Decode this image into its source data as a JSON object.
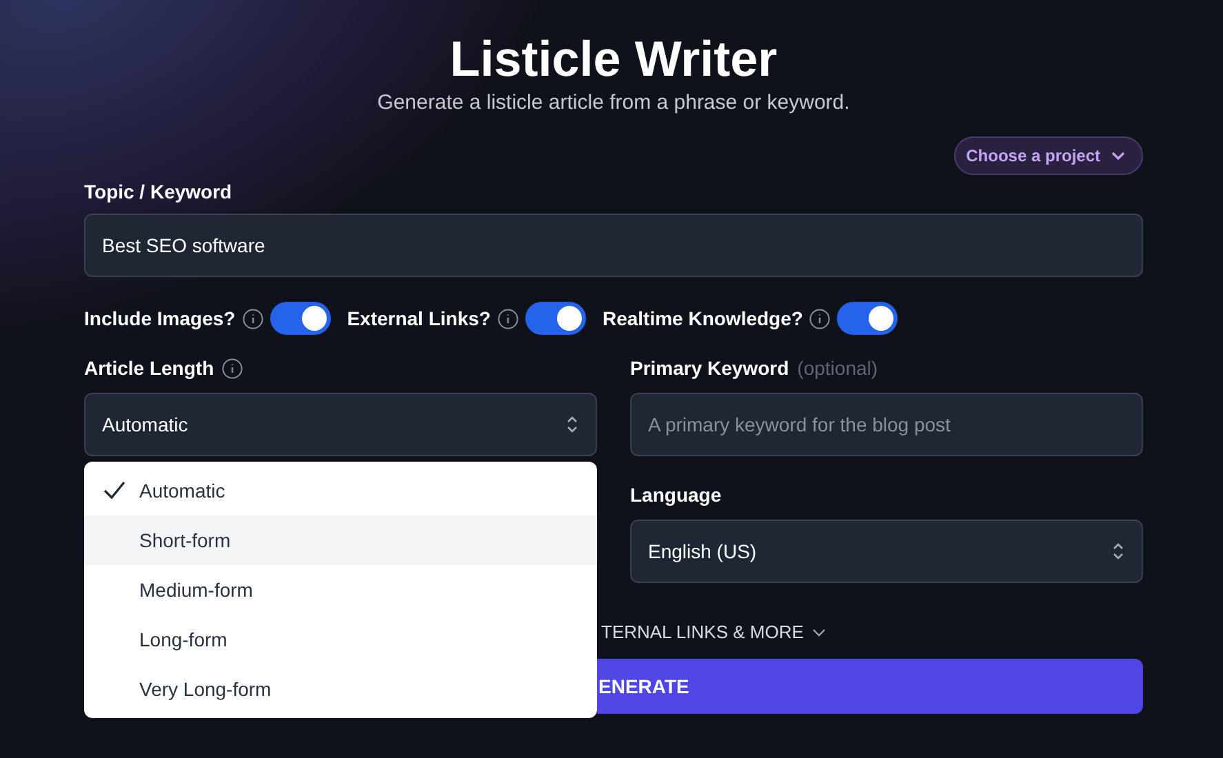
{
  "header": {
    "title": "Listicle Writer",
    "subtitle": "Generate a listicle article from a phrase or keyword."
  },
  "project_button": {
    "label": "Choose a project"
  },
  "topic": {
    "label": "Topic / Keyword",
    "value": "Best SEO software"
  },
  "toggles": [
    {
      "label": "Include Images?",
      "on": true
    },
    {
      "label": "External Links?",
      "on": true
    },
    {
      "label": "Realtime Knowledge?",
      "on": true
    }
  ],
  "article_length": {
    "label": "Article Length",
    "value": "Automatic"
  },
  "primary_keyword": {
    "label": "Primary Keyword",
    "hint": "(optional)",
    "placeholder": "A primary keyword for the blog post"
  },
  "language": {
    "label": "Language",
    "value": "English (US)"
  },
  "length_menu": [
    {
      "label": "Automatic",
      "selected": true,
      "highlighted": false
    },
    {
      "label": "Short-form",
      "selected": false,
      "highlighted": true
    },
    {
      "label": "Medium-form",
      "selected": false,
      "highlighted": false
    },
    {
      "label": "Long-form",
      "selected": false,
      "highlighted": false
    },
    {
      "label": "Very Long-form",
      "selected": false,
      "highlighted": false
    }
  ],
  "more_options": {
    "label": "TERNAL LINKS & MORE"
  },
  "generate_button": {
    "label": "ENERATE"
  }
}
